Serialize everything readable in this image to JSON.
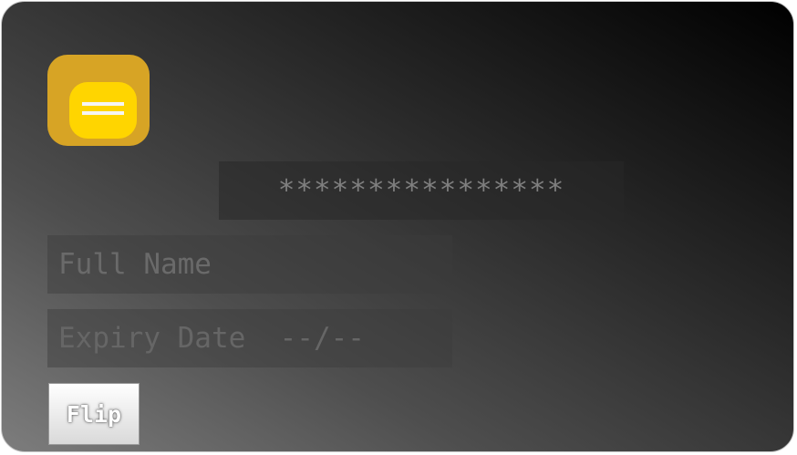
{
  "card": {
    "number_display": "****************",
    "name_placeholder": "Full Name",
    "expiry_placeholder": "Expiry Date  --/--",
    "flip_label": "Flip",
    "chip_icon": "chip-icon"
  },
  "colors": {
    "chip_outer": "#d7a425",
    "chip_inner": "#ffd500",
    "card_gradient_start": "#7d7d7d",
    "card_gradient_end": "#000000"
  }
}
